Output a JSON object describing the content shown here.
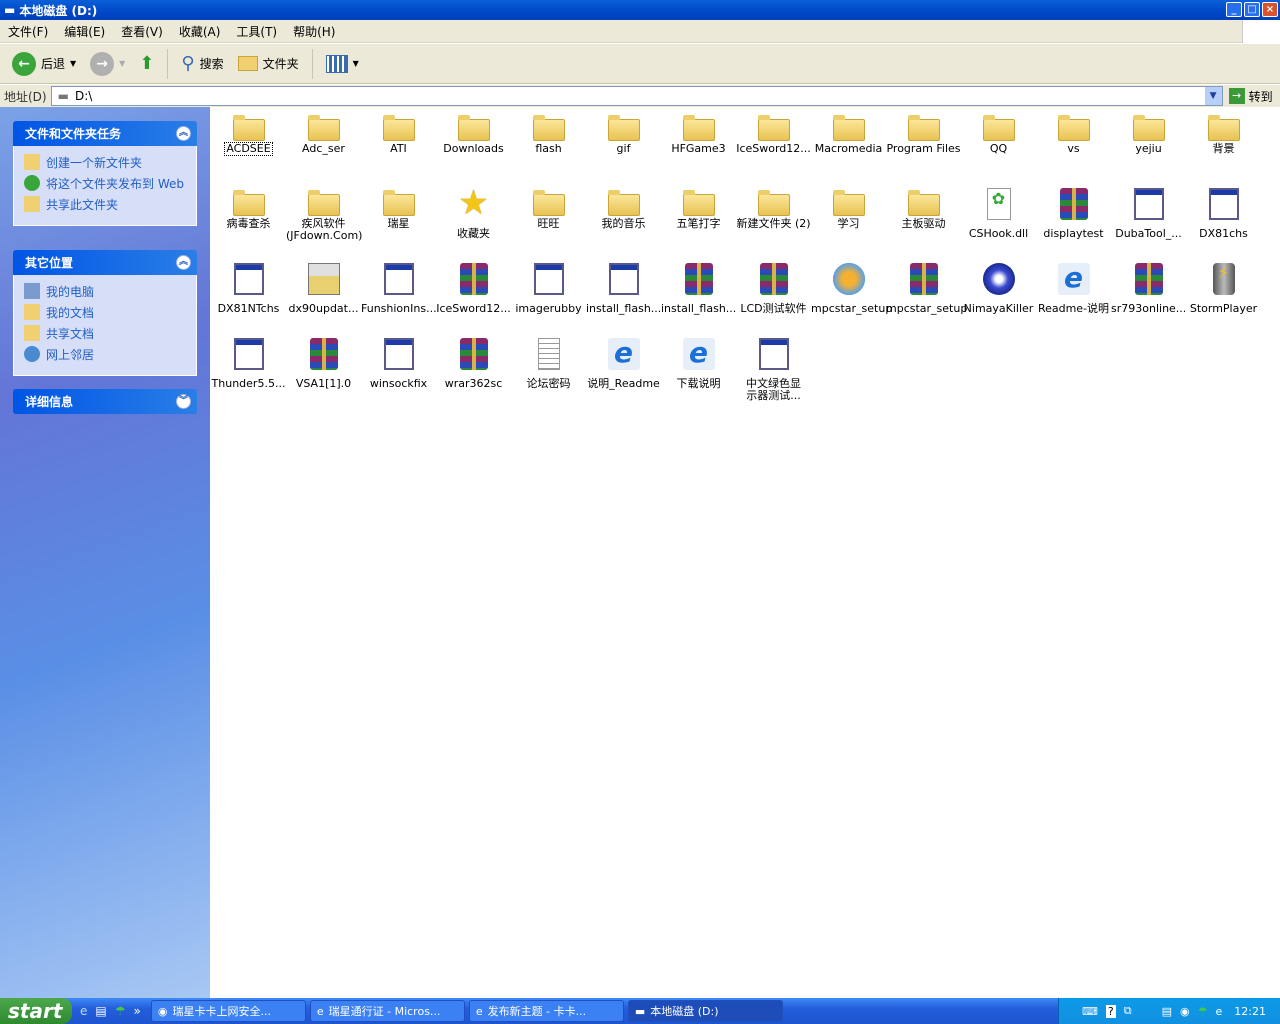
{
  "window": {
    "title": "本地磁盘 (D:)",
    "controls": [
      "_",
      "□",
      "×"
    ]
  },
  "menu": [
    "文件(F)",
    "编辑(E)",
    "查看(V)",
    "收藏(A)",
    "工具(T)",
    "帮助(H)"
  ],
  "toolbar": {
    "back": "后退",
    "search": "搜索",
    "folders": "文件夹"
  },
  "address": {
    "label": "地址(D)",
    "value": "D:\\",
    "go": "转到"
  },
  "sidebar": {
    "tasks": {
      "title": "文件和文件夹任务",
      "items": [
        "创建一个新文件夹",
        "将这个文件夹发布到 Web",
        "共享此文件夹"
      ]
    },
    "places": {
      "title": "其它位置",
      "items": [
        "我的电脑",
        "我的文档",
        "共享文档",
        "网上邻居"
      ]
    },
    "details": {
      "title": "详细信息"
    }
  },
  "files": [
    {
      "name": "ACDSEE",
      "type": "folder"
    },
    {
      "name": "Adc_ser",
      "type": "folder"
    },
    {
      "name": "ATI",
      "type": "folder"
    },
    {
      "name": "Downloads",
      "type": "folder"
    },
    {
      "name": "flash",
      "type": "folder"
    },
    {
      "name": "gif",
      "type": "folder"
    },
    {
      "name": "HFGame3",
      "type": "folder"
    },
    {
      "name": "IceSword12...",
      "type": "folder"
    },
    {
      "name": "Macromedia",
      "type": "folder"
    },
    {
      "name": "Program Files",
      "type": "folder"
    },
    {
      "name": "QQ",
      "type": "folder"
    },
    {
      "name": "vs",
      "type": "folder"
    },
    {
      "name": "yejiu",
      "type": "folder"
    },
    {
      "name": "背景",
      "type": "folder"
    },
    {
      "name": "病毒查杀",
      "type": "folder"
    },
    {
      "name": "疾风软件 (JFdown.Com)",
      "type": "folder"
    },
    {
      "name": "瑞星",
      "type": "folder"
    },
    {
      "name": "收藏夹",
      "type": "star"
    },
    {
      "name": "旺旺",
      "type": "folder"
    },
    {
      "name": "我的音乐",
      "type": "folder"
    },
    {
      "name": "五笔打字",
      "type": "folder"
    },
    {
      "name": "新建文件夹 (2)",
      "type": "folder"
    },
    {
      "name": "学习",
      "type": "folder"
    },
    {
      "name": "主板驱动",
      "type": "folder"
    },
    {
      "name": "CSHook.dll",
      "type": "dll"
    },
    {
      "name": "displaytest",
      "type": "rar"
    },
    {
      "name": "DubaTool_...",
      "type": "app"
    },
    {
      "name": "DX81chs",
      "type": "app"
    },
    {
      "name": "DX81NTchs",
      "type": "app"
    },
    {
      "name": "dx90updat...",
      "type": "setup"
    },
    {
      "name": "FunshionIns...",
      "type": "app"
    },
    {
      "name": "IceSword12...",
      "type": "rar"
    },
    {
      "name": "imagerubby",
      "type": "app"
    },
    {
      "name": "install_flash...",
      "type": "app"
    },
    {
      "name": "install_flash...",
      "type": "rar"
    },
    {
      "name": "LCD测试软件",
      "type": "rar"
    },
    {
      "name": "mpcstar_setup",
      "type": "mpc"
    },
    {
      "name": "mpcstar_setup",
      "type": "rar"
    },
    {
      "name": "NimayaKiller",
      "type": "nimaya"
    },
    {
      "name": "Readme-说明",
      "type": "ie"
    },
    {
      "name": "sr793online...",
      "type": "rar"
    },
    {
      "name": "StormPlayer",
      "type": "storm"
    },
    {
      "name": "Thunder5.5...",
      "type": "app"
    },
    {
      "name": "VSA1[1].0",
      "type": "rar"
    },
    {
      "name": "winsockfix",
      "type": "app"
    },
    {
      "name": "wrar362sc",
      "type": "rar"
    },
    {
      "name": "论坛密码",
      "type": "txt"
    },
    {
      "name": "说明_Readme",
      "type": "ie"
    },
    {
      "name": "下载说明",
      "type": "ie"
    },
    {
      "name": "中文绿色显示器测试...",
      "type": "app"
    }
  ],
  "taskbar": {
    "start": "start",
    "quicklaunch_more": "»",
    "tasks": [
      "瑞星卡卡上网安全...",
      "瑞星通行证 - Micros...",
      "发布新主题 - 卡卡...",
      "本地磁盘 (D:)"
    ],
    "clock": "12:21"
  }
}
